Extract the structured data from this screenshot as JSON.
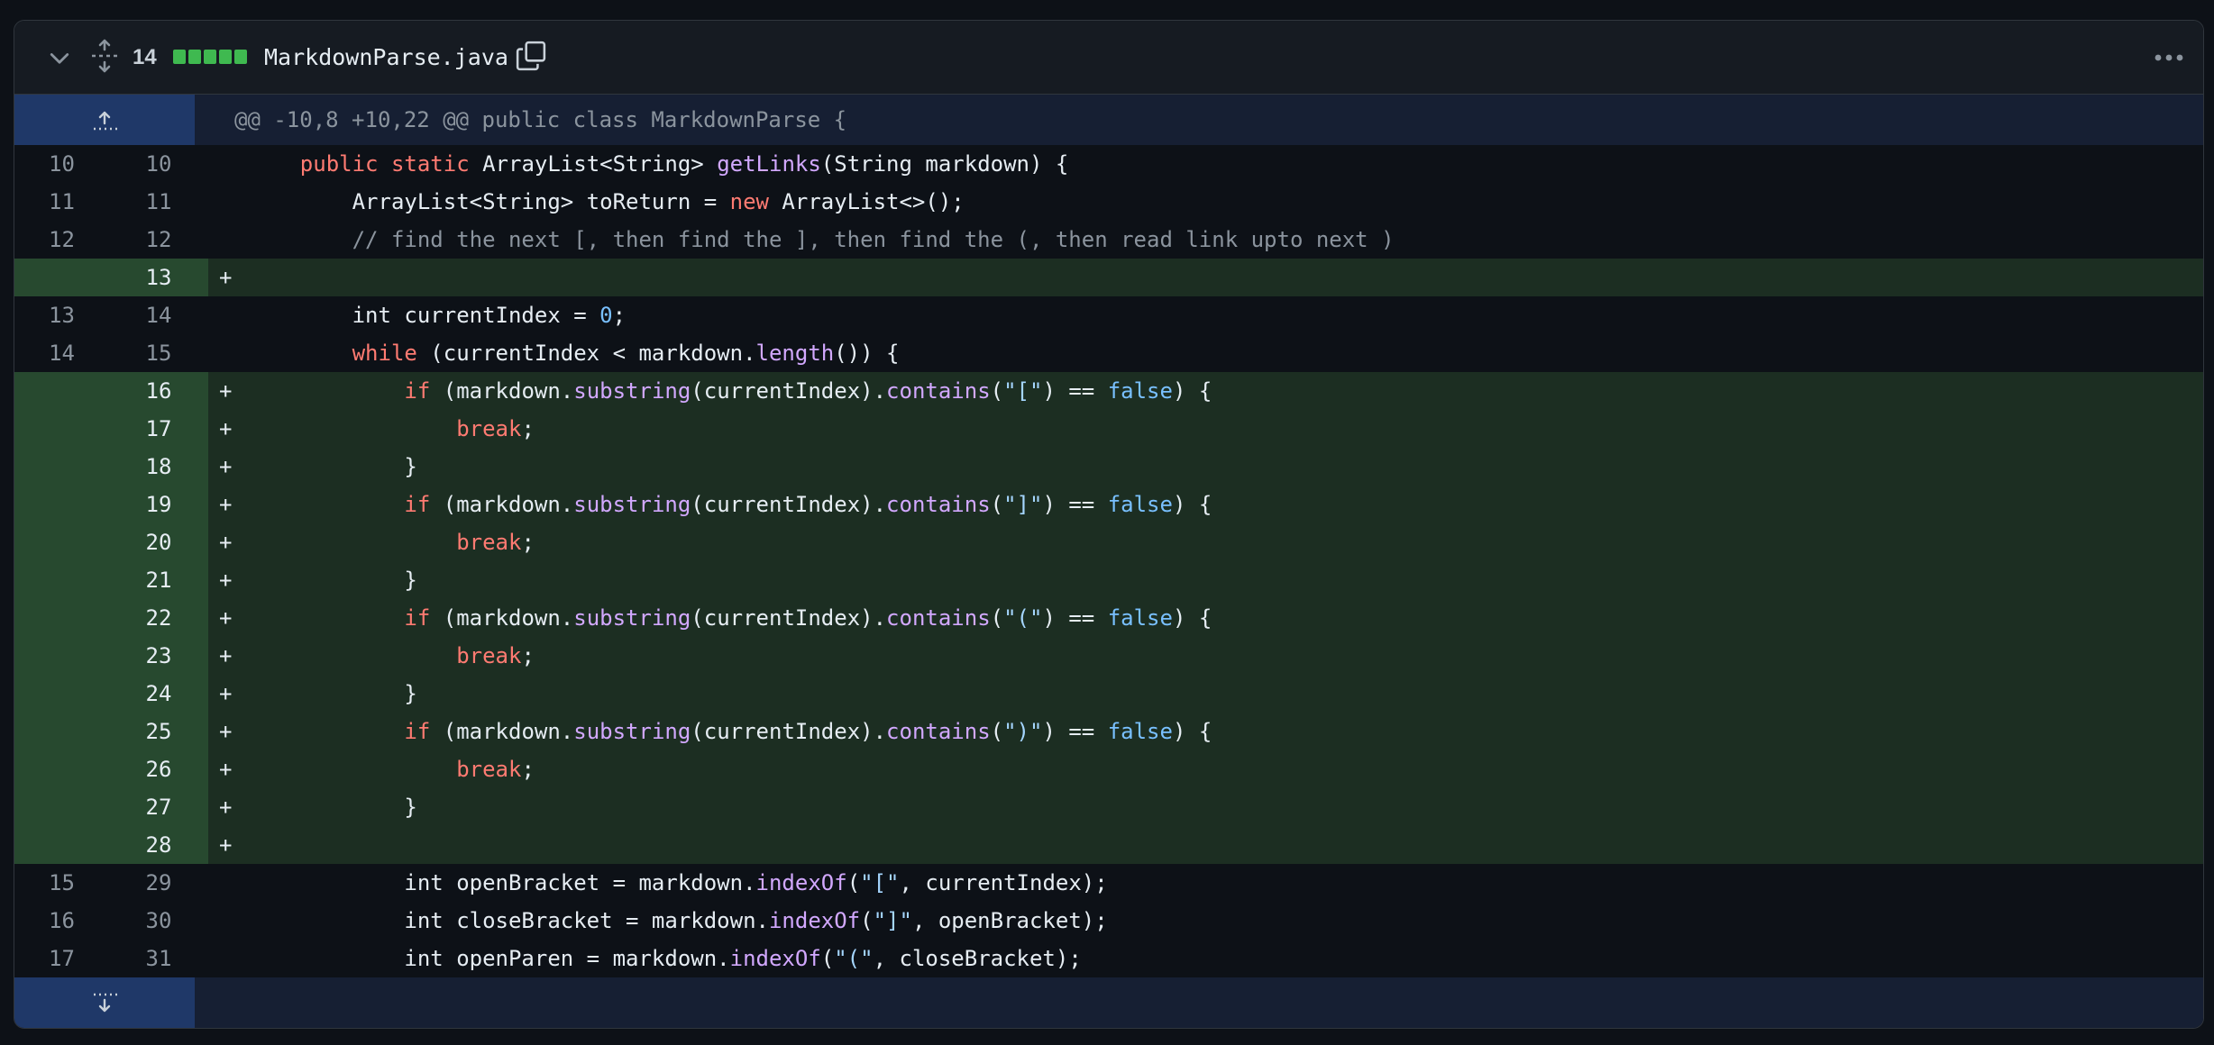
{
  "header": {
    "change_count": "14",
    "filename": "MarkdownParse.java"
  },
  "hunk_header": "@@ -10,8 +10,22 @@ public class MarkdownParse {",
  "lines": [
    {
      "old": "10",
      "new": "10",
      "sign": "",
      "type": "ctx",
      "tokens": [
        [
          "    ",
          ""
        ],
        [
          "public",
          "kw"
        ],
        [
          " ",
          ""
        ],
        [
          "static",
          "kw"
        ],
        [
          " ArrayList<String> ",
          ""
        ],
        [
          "getLinks",
          "fn"
        ],
        [
          "(String markdown) {",
          ""
        ]
      ]
    },
    {
      "old": "11",
      "new": "11",
      "sign": "",
      "type": "ctx",
      "tokens": [
        [
          "        ArrayList<String> toReturn = ",
          ""
        ],
        [
          "new",
          "kw"
        ],
        [
          " ArrayList<>();",
          ""
        ]
      ]
    },
    {
      "old": "12",
      "new": "12",
      "sign": "",
      "type": "ctx",
      "tokens": [
        [
          "        ",
          ""
        ],
        [
          "// find the next [, then find the ], then find the (, then read link upto next )",
          "cm"
        ]
      ]
    },
    {
      "old": "",
      "new": "13",
      "sign": "+",
      "type": "add",
      "tokens": []
    },
    {
      "old": "13",
      "new": "14",
      "sign": "",
      "type": "ctx",
      "tokens": [
        [
          "        int currentIndex = ",
          ""
        ],
        [
          "0",
          "num"
        ],
        [
          ";",
          ""
        ]
      ]
    },
    {
      "old": "14",
      "new": "15",
      "sign": "",
      "type": "ctx",
      "tokens": [
        [
          "        ",
          ""
        ],
        [
          "while",
          "kw"
        ],
        [
          " (currentIndex < markdown.",
          ""
        ],
        [
          "length",
          "fn"
        ],
        [
          "()) {",
          ""
        ]
      ]
    },
    {
      "old": "",
      "new": "16",
      "sign": "+",
      "type": "add",
      "tokens": [
        [
          "            ",
          ""
        ],
        [
          "if",
          "kw"
        ],
        [
          " (markdown.",
          ""
        ],
        [
          "substring",
          "fn"
        ],
        [
          "(currentIndex).",
          ""
        ],
        [
          "contains",
          "fn"
        ],
        [
          "(",
          ""
        ],
        [
          "\"[\"",
          "str"
        ],
        [
          ") == ",
          ""
        ],
        [
          "false",
          "con"
        ],
        [
          ") {",
          ""
        ]
      ]
    },
    {
      "old": "",
      "new": "17",
      "sign": "+",
      "type": "add",
      "tokens": [
        [
          "                ",
          ""
        ],
        [
          "break",
          "kw"
        ],
        [
          ";",
          ""
        ]
      ]
    },
    {
      "old": "",
      "new": "18",
      "sign": "+",
      "type": "add",
      "tokens": [
        [
          "            }",
          ""
        ]
      ]
    },
    {
      "old": "",
      "new": "19",
      "sign": "+",
      "type": "add",
      "tokens": [
        [
          "            ",
          ""
        ],
        [
          "if",
          "kw"
        ],
        [
          " (markdown.",
          ""
        ],
        [
          "substring",
          "fn"
        ],
        [
          "(currentIndex).",
          ""
        ],
        [
          "contains",
          "fn"
        ],
        [
          "(",
          ""
        ],
        [
          "\"]\"",
          "str"
        ],
        [
          ") == ",
          ""
        ],
        [
          "false",
          "con"
        ],
        [
          ") {",
          ""
        ]
      ]
    },
    {
      "old": "",
      "new": "20",
      "sign": "+",
      "type": "add",
      "tokens": [
        [
          "                ",
          ""
        ],
        [
          "break",
          "kw"
        ],
        [
          ";",
          ""
        ]
      ]
    },
    {
      "old": "",
      "new": "21",
      "sign": "+",
      "type": "add",
      "tokens": [
        [
          "            }",
          ""
        ]
      ]
    },
    {
      "old": "",
      "new": "22",
      "sign": "+",
      "type": "add",
      "tokens": [
        [
          "            ",
          ""
        ],
        [
          "if",
          "kw"
        ],
        [
          " (markdown.",
          ""
        ],
        [
          "substring",
          "fn"
        ],
        [
          "(currentIndex).",
          ""
        ],
        [
          "contains",
          "fn"
        ],
        [
          "(",
          ""
        ],
        [
          "\"(\"",
          "str"
        ],
        [
          ") == ",
          ""
        ],
        [
          "false",
          "con"
        ],
        [
          ") {",
          ""
        ]
      ]
    },
    {
      "old": "",
      "new": "23",
      "sign": "+",
      "type": "add",
      "tokens": [
        [
          "                ",
          ""
        ],
        [
          "break",
          "kw"
        ],
        [
          ";",
          ""
        ]
      ]
    },
    {
      "old": "",
      "new": "24",
      "sign": "+",
      "type": "add",
      "tokens": [
        [
          "            }",
          ""
        ]
      ]
    },
    {
      "old": "",
      "new": "25",
      "sign": "+",
      "type": "add",
      "tokens": [
        [
          "            ",
          ""
        ],
        [
          "if",
          "kw"
        ],
        [
          " (markdown.",
          ""
        ],
        [
          "substring",
          "fn"
        ],
        [
          "(currentIndex).",
          ""
        ],
        [
          "contains",
          "fn"
        ],
        [
          "(",
          ""
        ],
        [
          "\")\"",
          "str"
        ],
        [
          ") == ",
          ""
        ],
        [
          "false",
          "con"
        ],
        [
          ") {",
          ""
        ]
      ]
    },
    {
      "old": "",
      "new": "26",
      "sign": "+",
      "type": "add",
      "tokens": [
        [
          "                ",
          ""
        ],
        [
          "break",
          "kw"
        ],
        [
          ";",
          ""
        ]
      ]
    },
    {
      "old": "",
      "new": "27",
      "sign": "+",
      "type": "add",
      "tokens": [
        [
          "            }",
          ""
        ]
      ]
    },
    {
      "old": "",
      "new": "28",
      "sign": "+",
      "type": "add",
      "tokens": []
    },
    {
      "old": "15",
      "new": "29",
      "sign": "",
      "type": "ctx",
      "tokens": [
        [
          "            int openBracket = markdown.",
          ""
        ],
        [
          "indexOf",
          "fn"
        ],
        [
          "(",
          ""
        ],
        [
          "\"[\"",
          "str"
        ],
        [
          ", currentIndex);",
          ""
        ]
      ]
    },
    {
      "old": "16",
      "new": "30",
      "sign": "",
      "type": "ctx",
      "tokens": [
        [
          "            int closeBracket = markdown.",
          ""
        ],
        [
          "indexOf",
          "fn"
        ],
        [
          "(",
          ""
        ],
        [
          "\"]\"",
          "str"
        ],
        [
          ", openBracket);",
          ""
        ]
      ]
    },
    {
      "old": "17",
      "new": "31",
      "sign": "",
      "type": "ctx",
      "tokens": [
        [
          "            int openParen = markdown.",
          ""
        ],
        [
          "indexOf",
          "fn"
        ],
        [
          "(",
          ""
        ],
        [
          "\"(\"",
          "str"
        ],
        [
          ", closeBracket);",
          ""
        ]
      ]
    }
  ],
  "colors": {
    "added_bg": "#1c2e22",
    "added_gutter": "#27492f",
    "hunk_bg": "#161f33",
    "hunk_gutter": "#1f3868",
    "diffstat_green": "#3fb950"
  },
  "icons": [
    "chevron-down-icon",
    "expand-all-icon",
    "copy-icon",
    "kebab-horizontal-icon",
    "expand-up-icon",
    "expand-down-icon"
  ]
}
